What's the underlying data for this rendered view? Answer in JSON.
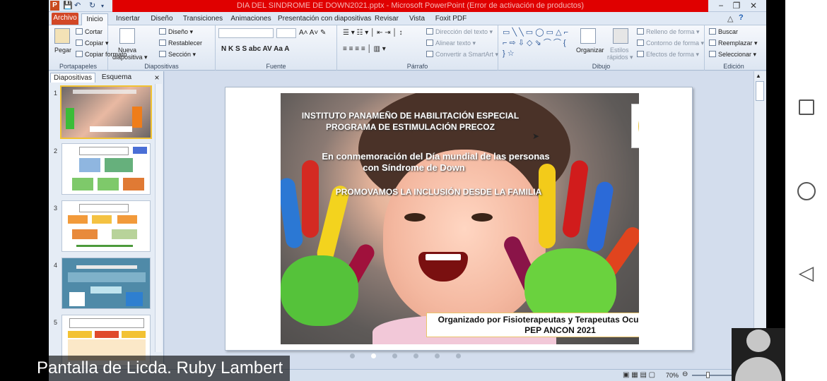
{
  "window": {
    "title": "DIA DEL SINDROME DE DOWN2021.pptx  -  Microsoft PowerPoint (Error de activación de productos)",
    "app_icon": "P"
  },
  "tabs": [
    "Archivo",
    "Inicio",
    "Insertar",
    "Diseño",
    "Transiciones",
    "Animaciones",
    "Presentación con diapositivas",
    "Revisar",
    "Vista",
    "Foxit PDF"
  ],
  "ribbon": {
    "portapapeles": {
      "label": "Portapapeles",
      "pegar": "Pegar",
      "cortar": "Cortar",
      "copiar": "Copiar",
      "copiar_formato": "Copiar formato"
    },
    "diapositivas": {
      "label": "Diapositivas",
      "nueva": "Nueva",
      "nueva2": "diapositiva",
      "diseno": "Diseño",
      "restablecer": "Restablecer",
      "seccion": "Sección"
    },
    "fuente": {
      "label": "Fuente",
      "letters": "N  K  S  S  abc  AV  Aa  A"
    },
    "parrafo": {
      "label": "Párrafo",
      "direccion": "Dirección del texto",
      "alinear": "Alinear texto",
      "smartart": "Convertir a SmartArt"
    },
    "dibujo": {
      "label": "Dibujo",
      "organizar": "Organizar",
      "estilos": "Estilos",
      "estilos2": "rápidos",
      "relleno": "Relleno de forma",
      "contorno": "Contorno de forma",
      "efectos": "Efectos de forma"
    },
    "edicion": {
      "label": "Edición",
      "buscar": "Buscar",
      "reemplazar": "Reemplazar",
      "seleccionar": "Seleccionar"
    }
  },
  "panel": {
    "tab_diapositivas": "Diapositivas",
    "tab_esquema": "Esquema",
    "close": "×",
    "slide_numbers": [
      "1",
      "2",
      "3",
      "4",
      "5"
    ]
  },
  "slide": {
    "line1": "INSTITUTO PANAMEÑO DE HABILITACIÓN ESPECIAL",
    "line2": "PROGRAMA DE ESTIMULACIÓN PRECOZ",
    "line3": "En conmemoración del Día mundial de las personas",
    "line4": "con Síndrome de Down",
    "line5": "PROMOVAMOS LA INCLUSIÓN DESDE LA FAMILIA",
    "org1": "Organizado por Fisioterapeutas y Terapeutas Ocupacionales",
    "org2": "PEP ANCON 2021"
  },
  "status": {
    "zoom": "70%"
  },
  "caption": "Pantalla de Licda. Ruby Lambert",
  "colors": {
    "titlebar": "#e00000",
    "file_tab": "#d24726",
    "selection": "#f1c232"
  }
}
